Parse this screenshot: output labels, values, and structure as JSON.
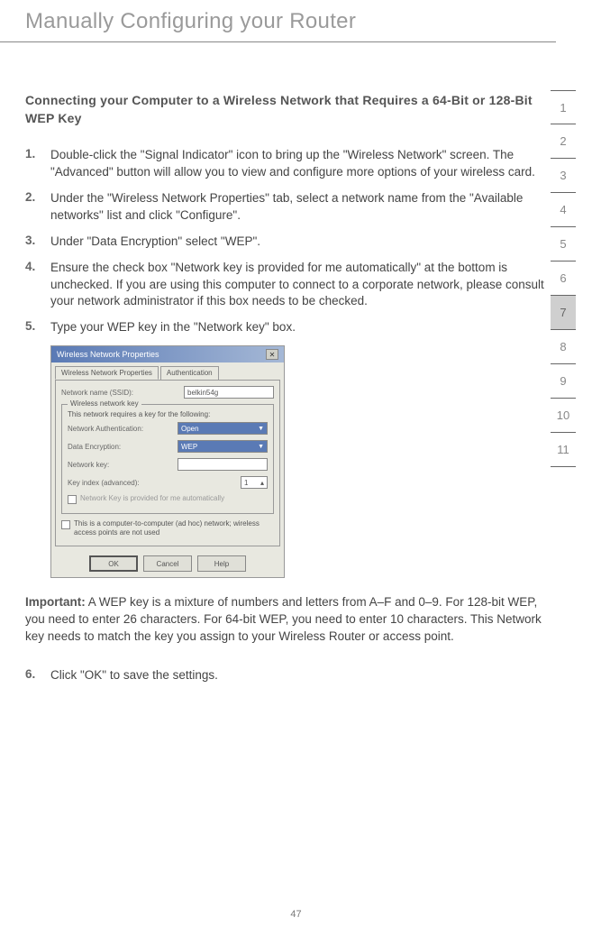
{
  "page": {
    "title": "Manually Configuring your Router",
    "number": "47"
  },
  "section": {
    "heading": "Connecting your Computer to a Wireless Network that Requires a 64-Bit or 128-Bit WEP Key"
  },
  "steps": [
    {
      "num": "1.",
      "text": "Double-click the \"Signal Indicator\" icon to bring up the \"Wireless Network\" screen. The \"Advanced\" button will allow you to view and configure more options of your wireless card."
    },
    {
      "num": "2.",
      "text": "Under the \"Wireless Network Properties\" tab, select a network name from the \"Available networks\" list and click \"Configure\"."
    },
    {
      "num": "3.",
      "text": "Under \"Data Encryption\" select \"WEP\"."
    },
    {
      "num": "4.",
      "text": "Ensure the check box \"Network key is provided for me automatically\" at the bottom is unchecked. If you are using this computer to connect to a corporate network, please consult your network administrator if this box needs to be checked."
    },
    {
      "num": "5.",
      "text": "Type your WEP key in the \"Network key\" box."
    }
  ],
  "dialog": {
    "title": "Wireless Network Properties",
    "tabs": [
      "Wireless Network Properties",
      "Authentication"
    ],
    "ssid_label": "Network name (SSID):",
    "ssid_value": "belkin54g",
    "group_label": "Wireless network key",
    "group_desc": "This network requires a key for the following:",
    "auth_label": "Network Authentication:",
    "auth_value": "Open",
    "enc_label": "Data Encryption:",
    "enc_value": "WEP",
    "key_label": "Network key:",
    "idx_label": "Key index (advanced):",
    "idx_value": "1",
    "auto_cb": "Network Key is provided for me automatically",
    "adhoc_cb": "This is a computer-to-computer (ad hoc) network; wireless access points are not used",
    "buttons": {
      "ok": "OK",
      "cancel": "Cancel",
      "help": "Help"
    }
  },
  "important": {
    "label": "Important:",
    "text": " A WEP key is a mixture of numbers and letters from A–F and 0–9. For 128-bit WEP, you need to enter 26 characters. For 64-bit WEP, you need to enter 10 characters. This Network key needs to match the key you assign to your Wireless Router or access point."
  },
  "step6": {
    "num": "6.",
    "text": "Click \"OK\" to save the settings."
  },
  "nav": {
    "items": [
      "1",
      "2",
      "3",
      "4",
      "5",
      "6",
      "7",
      "8",
      "9",
      "10",
      "11"
    ],
    "active": "7"
  }
}
